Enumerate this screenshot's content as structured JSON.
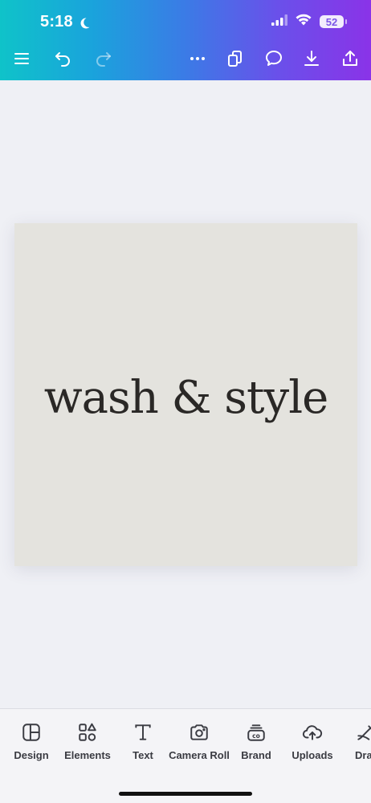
{
  "status": {
    "time": "5:18",
    "battery": "52"
  },
  "toolbar": {
    "menu_icon": "hamburger-icon",
    "undo_icon": "undo-icon",
    "redo_icon": "redo-icon",
    "more_icon": "more-horizontal-icon",
    "pages_icon": "pages-icon",
    "comment_icon": "comment-icon",
    "download_icon": "download-icon",
    "share_icon": "share-icon"
  },
  "design": {
    "text": "wash & style",
    "background": "#e4e3de"
  },
  "bottom_nav": {
    "items": [
      {
        "label": "Design",
        "icon": "layout-icon"
      },
      {
        "label": "Elements",
        "icon": "shapes-icon"
      },
      {
        "label": "Text",
        "icon": "text-icon"
      },
      {
        "label": "Camera Roll",
        "icon": "camera-icon"
      },
      {
        "label": "Brand",
        "icon": "brand-icon"
      },
      {
        "label": "Uploads",
        "icon": "upload-cloud-icon"
      },
      {
        "label": "Draw",
        "icon": "draw-icon"
      }
    ]
  },
  "colors": {
    "gradient_start": "#0fc3c9",
    "gradient_end": "#8a33e8",
    "canvas_bg": "#eff0f5"
  }
}
